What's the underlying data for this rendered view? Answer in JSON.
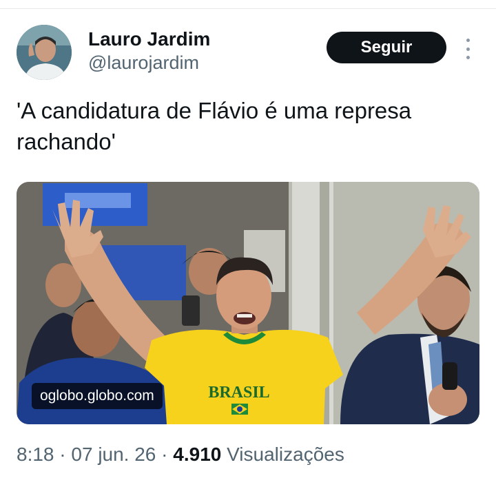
{
  "author": {
    "display_name": "Lauro Jardim",
    "handle": "@laurojardim"
  },
  "follow_label": "Seguir",
  "tweet_text": "'A candidatura de Flávio é uma represa rachando'",
  "media": {
    "source_label": "oglobo.globo.com",
    "shirt_text": "BRASIL"
  },
  "meta": {
    "time": "8:18",
    "separator1": " · ",
    "date": "07 jun. 26",
    "separator2": " · ",
    "views_count": "4.910",
    "views_label": " Visualizações"
  }
}
